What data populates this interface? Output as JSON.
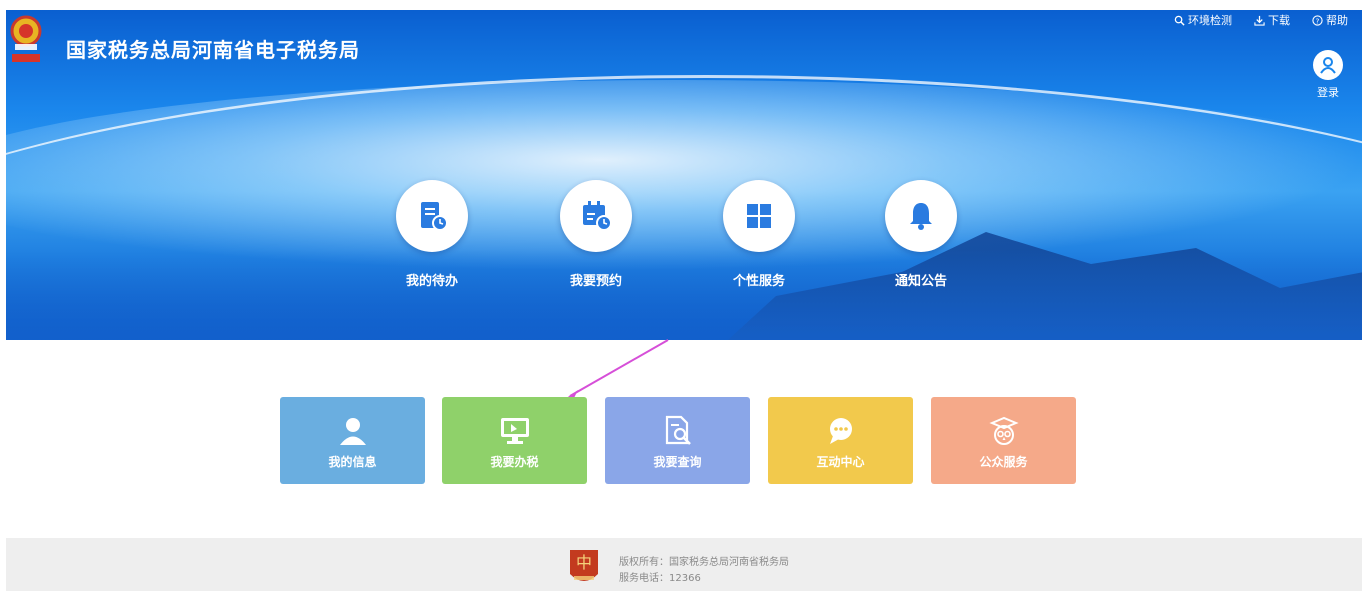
{
  "header": {
    "title": "国家税务总局河南省电子税务局",
    "top_links": [
      {
        "label": "环境检测",
        "icon": "magnifier-icon"
      },
      {
        "label": "下载",
        "icon": "download-icon"
      },
      {
        "label": "帮助",
        "icon": "help-icon"
      }
    ],
    "login_label": "登录"
  },
  "circle_nav": [
    {
      "label": "我的待办",
      "icon": "todo-document-icon"
    },
    {
      "label": "我要预约",
      "icon": "calendar-clock-icon"
    },
    {
      "label": "个性服务",
      "icon": "grid-icon"
    },
    {
      "label": "通知公告",
      "icon": "bell-icon"
    }
  ],
  "tiles": [
    {
      "label": "我的信息",
      "icon": "user-icon",
      "color": "#6aaee0"
    },
    {
      "label": "我要办税",
      "icon": "monitor-icon",
      "color": "#8fd16a"
    },
    {
      "label": "我要查询",
      "icon": "document-search-icon",
      "color": "#8aa6e8"
    },
    {
      "label": "互动中心",
      "icon": "chat-bubble-icon",
      "color": "#f2c94c"
    },
    {
      "label": "公众服务",
      "icon": "owl-icon",
      "color": "#f5a989"
    }
  ],
  "footer": {
    "copyright": "版权所有：国家税务总局河南省税务局",
    "phone": "服务电话：12366"
  },
  "colors": {
    "banner_blue": "#1a86ec",
    "arrow": "#d64fd8",
    "footer_bg": "#eeeeee"
  }
}
